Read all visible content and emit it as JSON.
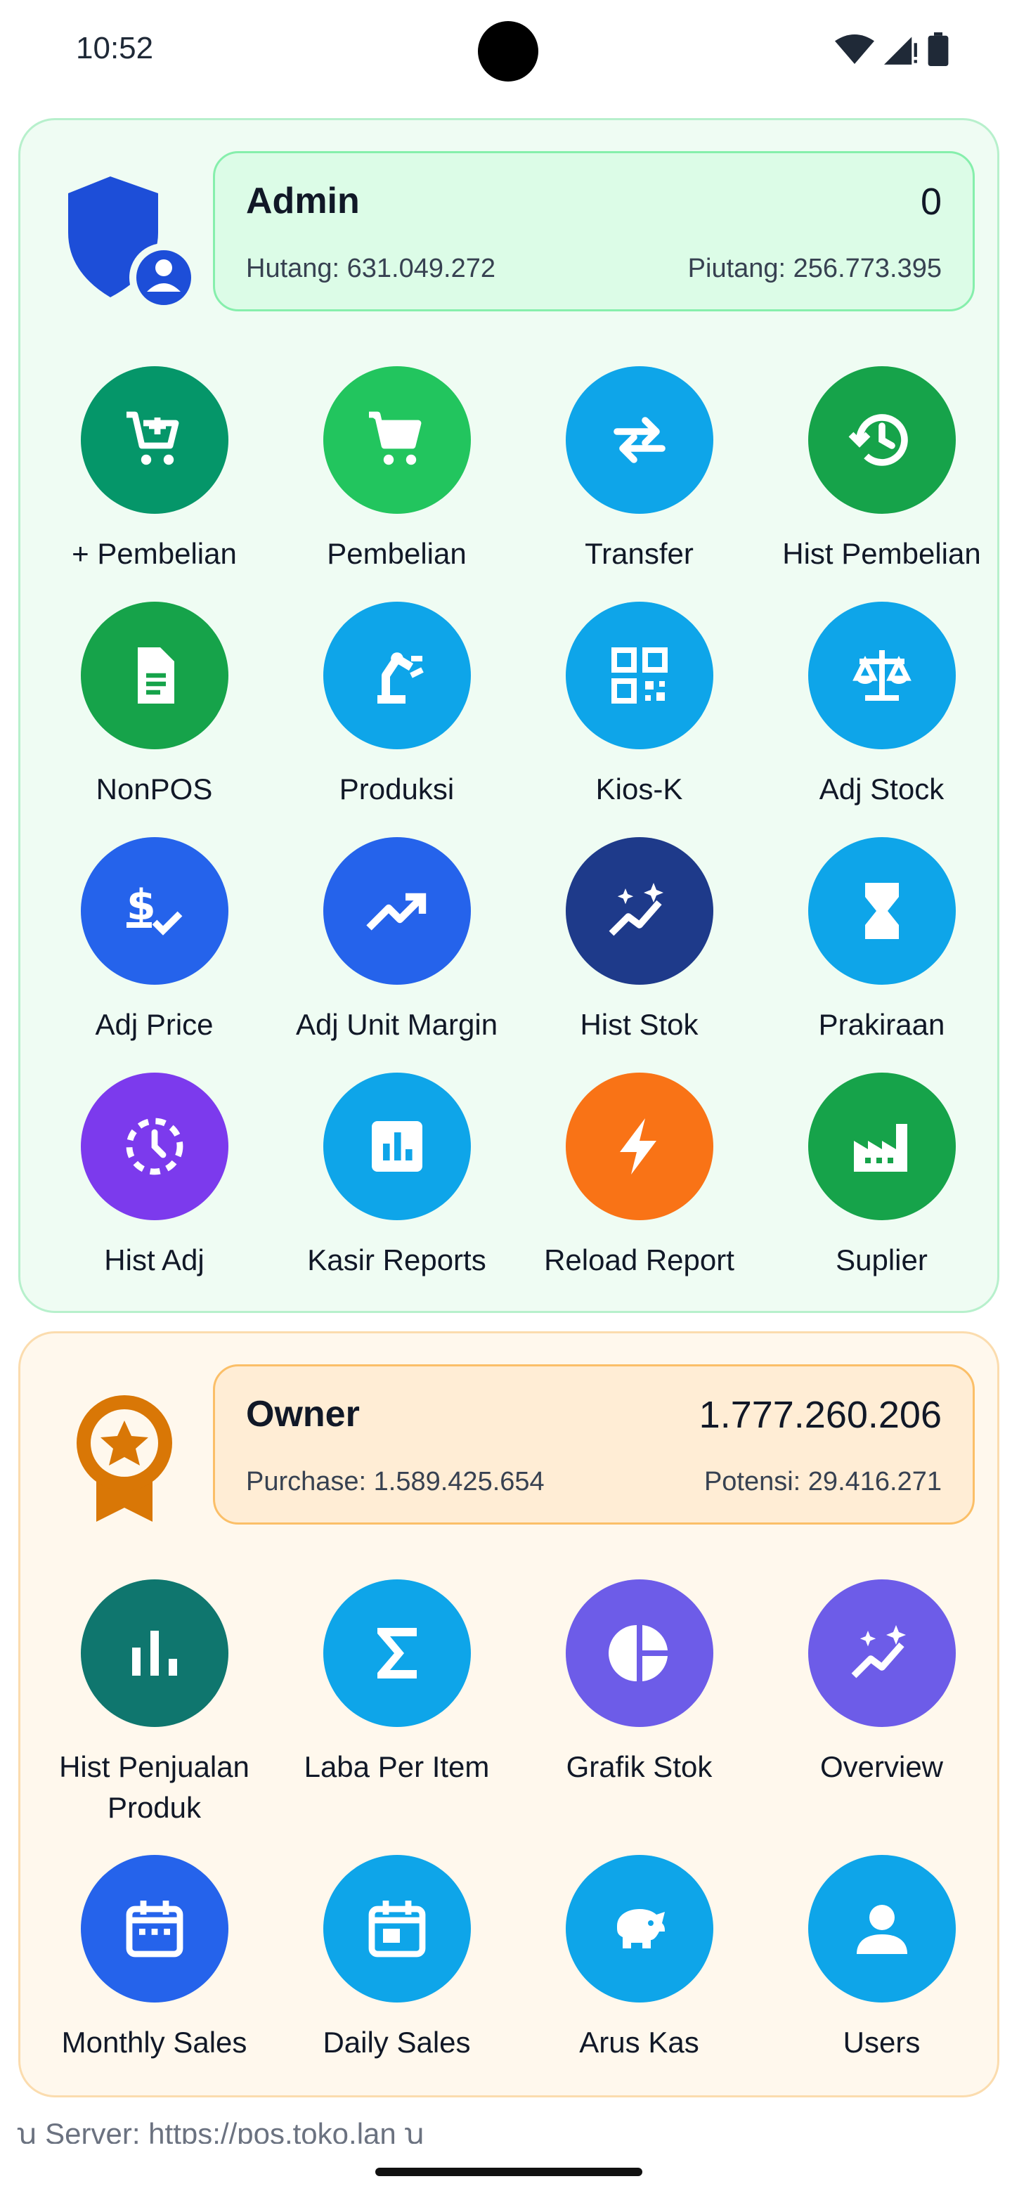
{
  "status_bar": {
    "time": "10:52"
  },
  "admin": {
    "title": "Admin",
    "value": "0",
    "left_text": "Hutang: 631.049.272",
    "right_text": "Piutang: 256.773.395",
    "tiles": [
      {
        "label": "+ Pembelian",
        "color": "#059669",
        "icon": "cart-plus-icon"
      },
      {
        "label": "Pembelian",
        "color": "#22c55e",
        "icon": "cart-icon"
      },
      {
        "label": "Transfer",
        "color": "#0ea5e9",
        "icon": "swap-arrows-icon"
      },
      {
        "label": "Hist Pembelian",
        "color": "#16a34a",
        "icon": "history-icon"
      },
      {
        "label": "NonPOS",
        "color": "#16a34a",
        "icon": "document-icon"
      },
      {
        "label": "Produksi",
        "color": "#0ea5e9",
        "icon": "robot-arm-icon"
      },
      {
        "label": "Kios-K",
        "color": "#0ea5e9",
        "icon": "qr-code-icon"
      },
      {
        "label": "Adj Stock",
        "color": "#0ea5e9",
        "icon": "scale-icon"
      },
      {
        "label": "Adj Price",
        "color": "#2563eb",
        "icon": "price-check-icon"
      },
      {
        "label": "Adj Unit Margin",
        "color": "#2563eb",
        "icon": "trend-up-icon"
      },
      {
        "label": "Hist Stok",
        "color": "#1e3a8a",
        "icon": "sparkle-chart-icon"
      },
      {
        "label": "Prakiraan",
        "color": "#0ea5e9",
        "icon": "hourglass-icon"
      },
      {
        "label": "Hist Adj",
        "color": "#7c3aed",
        "icon": "clock-dashed-icon"
      },
      {
        "label": "Kasir Reports",
        "color": "#0ea5e9",
        "icon": "bar-chart-box-icon"
      },
      {
        "label": "Reload Report",
        "color": "#f97316",
        "icon": "bolt-icon"
      },
      {
        "label": "Suplier",
        "color": "#16a34a",
        "icon": "factory-icon"
      }
    ]
  },
  "owner": {
    "title": "Owner",
    "value": "1.777.260.206",
    "left_text": "Purchase: 1.589.425.654",
    "right_text": "Potensi: 29.416.271",
    "tiles": [
      {
        "label": "Hist Penjualan Produk",
        "color": "#0f766e",
        "icon": "bar-chart-icon"
      },
      {
        "label": "Laba Per Item",
        "color": "#0ea5e9",
        "icon": "sigma-icon"
      },
      {
        "label": "Grafik Stok",
        "color": "#6d5ce8",
        "icon": "pie-chart-icon"
      },
      {
        "label": "Overview",
        "color": "#6d5ce8",
        "icon": "sparkle-chart-icon"
      },
      {
        "label": "Monthly Sales",
        "color": "#2563eb",
        "icon": "calendar-month-icon"
      },
      {
        "label": "Daily Sales",
        "color": "#0ea5e9",
        "icon": "calendar-day-icon"
      },
      {
        "label": "Arus Kas",
        "color": "#0ea5e9",
        "icon": "piggy-bank-icon"
      },
      {
        "label": "Users",
        "color": "#0ea5e9",
        "icon": "user-icon"
      }
    ]
  },
  "footer": {
    "server_text": "ꭒ Server: https://pos.toko.lan ꭒ"
  }
}
